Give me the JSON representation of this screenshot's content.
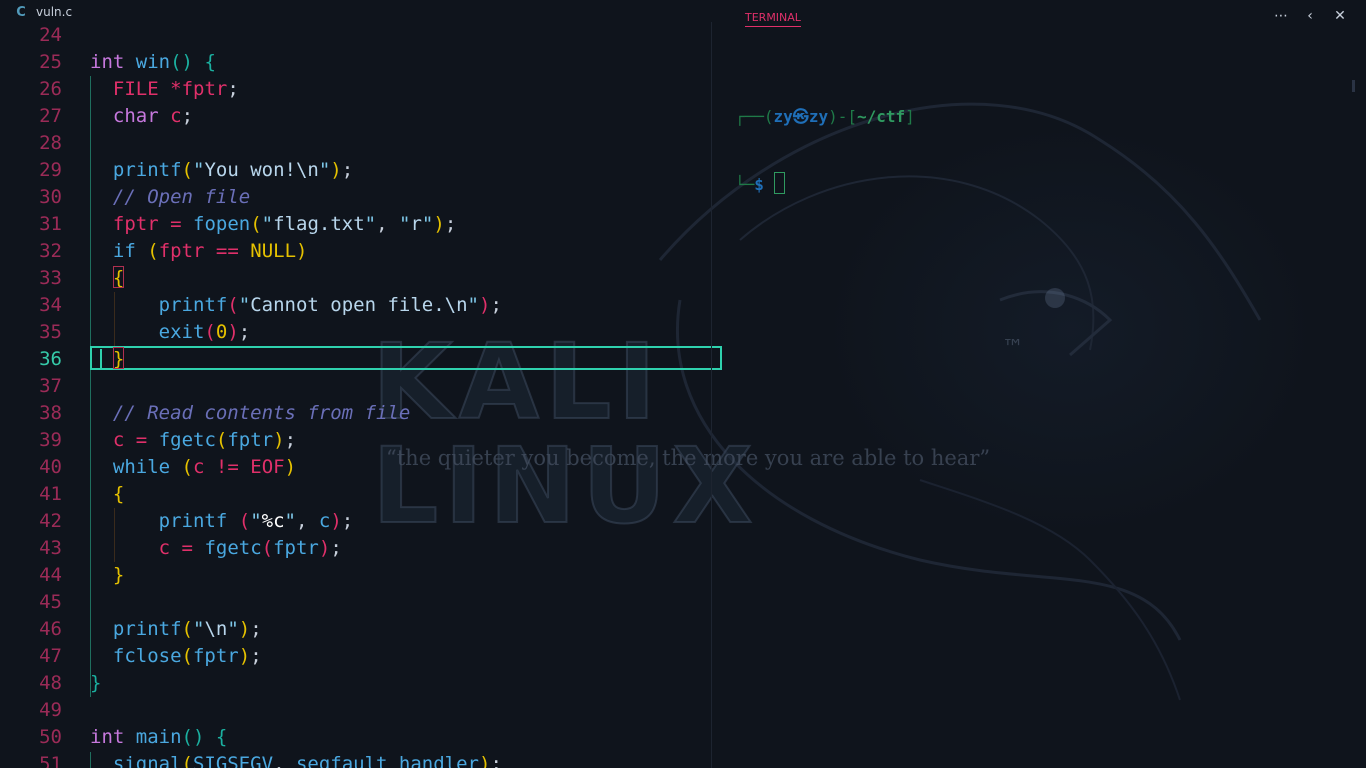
{
  "tab": {
    "icon": "c-language-icon",
    "icon_glyph": "C",
    "label": "vuln.c"
  },
  "editor": {
    "line_numbers": [
      "24",
      "25",
      "26",
      "27",
      "28",
      "29",
      "30",
      "31",
      "32",
      "33",
      "34",
      "35",
      "36",
      "37",
      "38",
      "39",
      "40",
      "41",
      "42",
      "43",
      "44",
      "45",
      "46",
      "47",
      "48",
      "49",
      "50",
      "51"
    ],
    "active_line": "36"
  },
  "background": {
    "logo": "KALI LINUX",
    "tm": "™",
    "tagline": "“the quieter you become, the more you are able to hear”"
  },
  "panel": {
    "tab_label": "TERMINAL",
    "actions": [
      {
        "name": "more-actions-icon",
        "glyph": "⋯"
      },
      {
        "name": "chevron-left-icon",
        "glyph": "‹"
      },
      {
        "name": "close-icon",
        "glyph": "✕"
      }
    ]
  },
  "terminal": {
    "user": "zy",
    "skull": "㉿",
    "host": "zy",
    "path": "~/ctf",
    "prompt": "$"
  },
  "colors": {
    "accent": "#2fd1ae",
    "line_number": "#9b2b57",
    "terminal_tab": "#e0306a"
  }
}
